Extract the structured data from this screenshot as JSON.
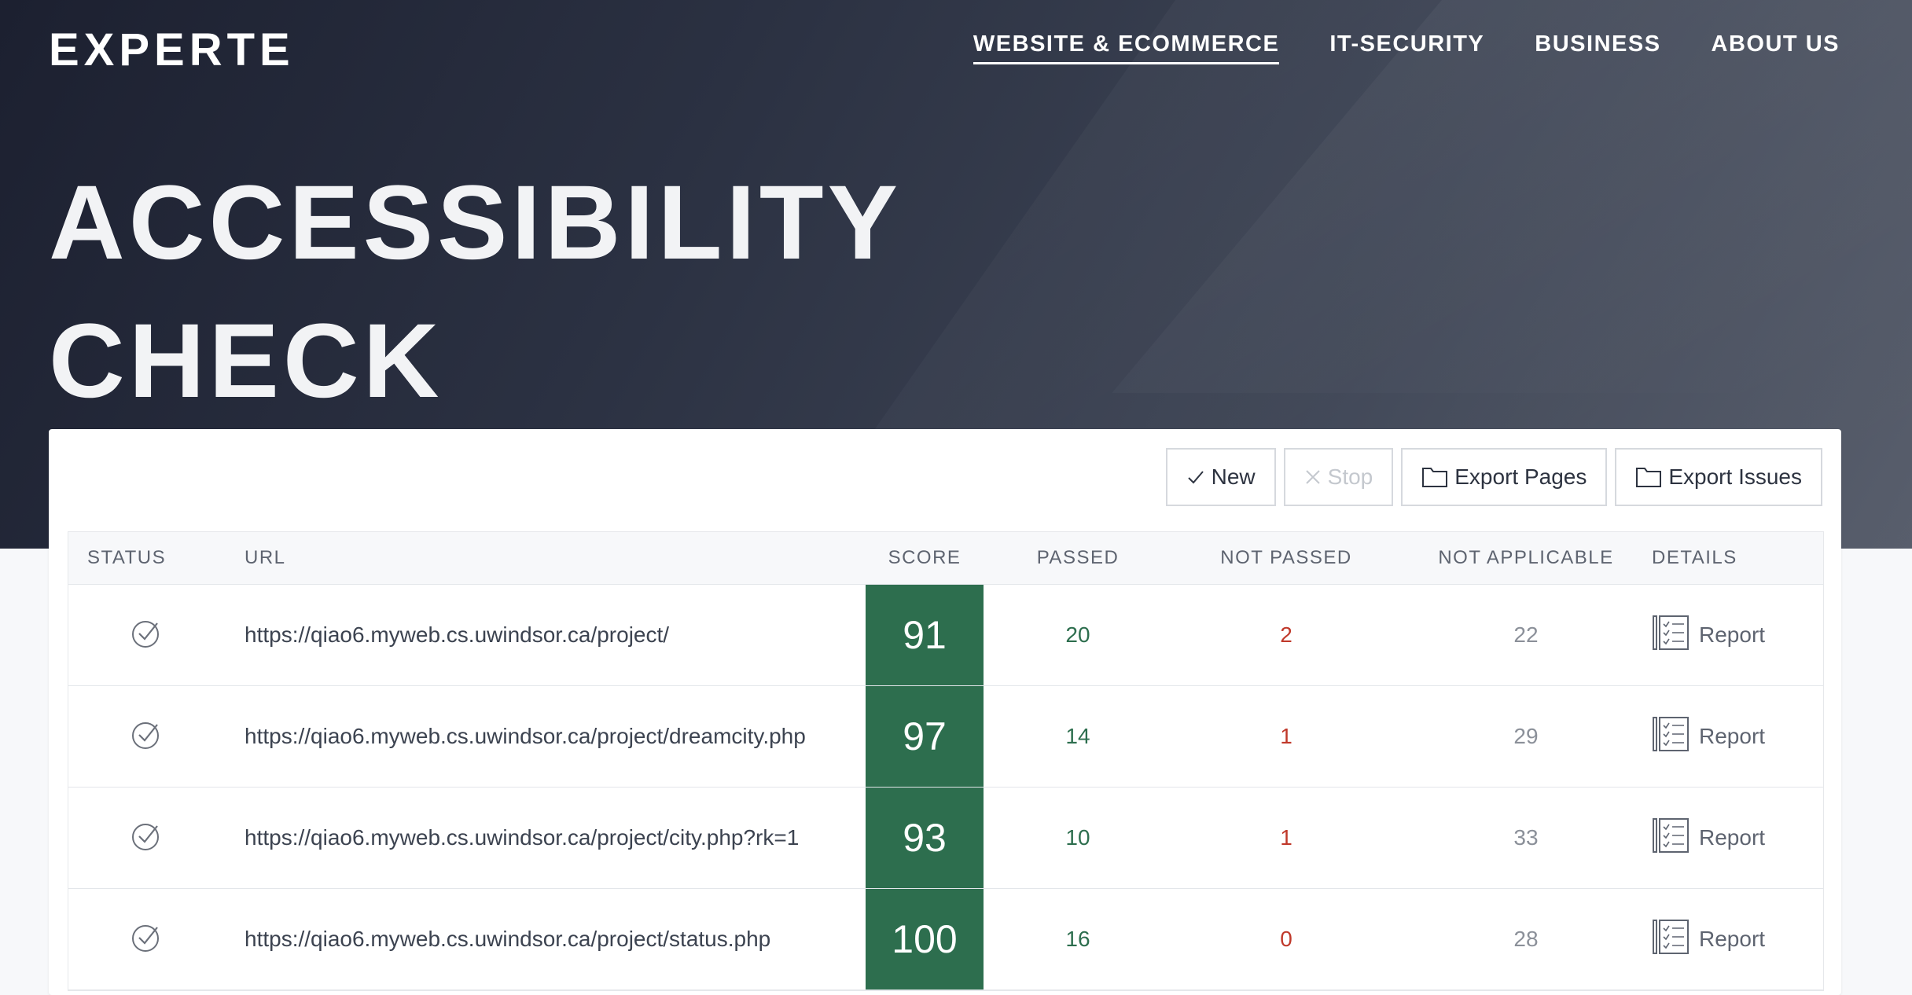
{
  "header": {
    "logo": "EXPERTE",
    "nav": [
      {
        "label": "WEBSITE & ECOMMERCE",
        "active": true
      },
      {
        "label": "IT-SECURITY",
        "active": false
      },
      {
        "label": "BUSINESS",
        "active": false
      },
      {
        "label": "ABOUT US",
        "active": false
      }
    ]
  },
  "hero": {
    "title_line1": "ACCESSIBILITY",
    "title_line2": "CHECK"
  },
  "toolbar": {
    "new_label": "New",
    "stop_label": "Stop",
    "export_pages_label": "Export Pages",
    "export_issues_label": "Export Issues"
  },
  "table": {
    "columns": [
      "STATUS",
      "URL",
      "SCORE",
      "PASSED",
      "NOT PASSED",
      "NOT APPLICABLE",
      "DETAILS"
    ],
    "rows": [
      {
        "url": "https://qiao6.myweb.cs.uwindsor.ca/project/",
        "score": "91",
        "passed": "20",
        "not_passed": "2",
        "not_applicable": "22",
        "details": "Report"
      },
      {
        "url": "https://qiao6.myweb.cs.uwindsor.ca/project/dreamcity.php",
        "score": "97",
        "passed": "14",
        "not_passed": "1",
        "not_applicable": "29",
        "details": "Report"
      },
      {
        "url": "https://qiao6.myweb.cs.uwindsor.ca/project/city.php?rk=1",
        "score": "93",
        "passed": "10",
        "not_passed": "1",
        "not_applicable": "33",
        "details": "Report"
      },
      {
        "url": "https://qiao6.myweb.cs.uwindsor.ca/project/status.php",
        "score": "100",
        "passed": "16",
        "not_passed": "0",
        "not_applicable": "28",
        "details": "Report"
      }
    ]
  },
  "icons": {
    "status": "check-circle-icon",
    "report": "checklist-icon",
    "new": "check-icon",
    "stop": "x-icon",
    "export": "folder-icon"
  },
  "colors": {
    "score_bg": "#2d6e4e",
    "passed": "#2d6e4e",
    "not_passed": "#c0392b",
    "not_applicable": "#8b9099"
  }
}
